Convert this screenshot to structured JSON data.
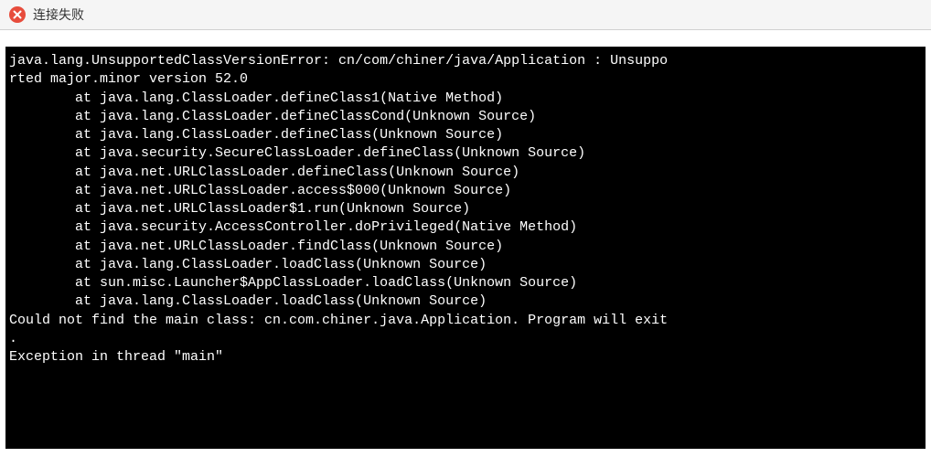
{
  "header": {
    "title": "连接失败",
    "icon": "error-icon"
  },
  "terminal": {
    "lines": [
      "java.lang.UnsupportedClassVersionError: cn/com/chiner/java/Application : Unsuppo",
      "rted major.minor version 52.0",
      "        at java.lang.ClassLoader.defineClass1(Native Method)",
      "        at java.lang.ClassLoader.defineClassCond(Unknown Source)",
      "        at java.lang.ClassLoader.defineClass(Unknown Source)",
      "        at java.security.SecureClassLoader.defineClass(Unknown Source)",
      "        at java.net.URLClassLoader.defineClass(Unknown Source)",
      "        at java.net.URLClassLoader.access$000(Unknown Source)",
      "        at java.net.URLClassLoader$1.run(Unknown Source)",
      "        at java.security.AccessController.doPrivileged(Native Method)",
      "        at java.net.URLClassLoader.findClass(Unknown Source)",
      "        at java.lang.ClassLoader.loadClass(Unknown Source)",
      "        at sun.misc.Launcher$AppClassLoader.loadClass(Unknown Source)",
      "        at java.lang.ClassLoader.loadClass(Unknown Source)",
      "Could not find the main class: cn.com.chiner.java.Application. Program will exit",
      ".",
      "Exception in thread \"main\" "
    ]
  }
}
